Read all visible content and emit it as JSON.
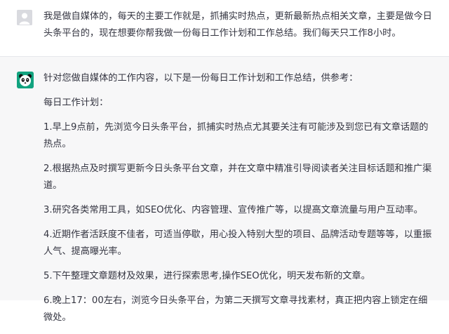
{
  "user_message": {
    "text": "我是做自媒体的，每天的主要工作就是，抓捕实时热点，更新最新热点相关文章，主要是做今日头条平台的，现在想要你帮我做一份每日工作计划和工作总结。我们每天只工作8小时。"
  },
  "assistant_message": {
    "intro": "针对您做自媒体的工作内容，以下是一份每日工作计划和工作总结，供参考：",
    "plan_title": "每日工作计划：",
    "items": [
      "1.早上9点前，先浏览今日头条平台，抓捕实时热点尤其要关注有可能涉及到您已有文章话题的热点。",
      "2.根据热点及时撰写更新今日头条平台文章，并在文章中精准引导阅读者关注目标话题和推广渠道。",
      "3.研究各类常用工具，如SEO优化、内容管理、宣传推广等，以提高文章流量与用户互动率。",
      "4.近期作者活跃度不佳者，可适当停歇，用心投入特别大型的项目、品牌活动专题等等，以重振人气、提高曝光率。",
      "5.下午整理文章题材及效果，进行探索思考,操作SEO优化，明天发布新的文章。",
      "6.晚上17：00左右，浏览今日头条平台，为第二天撰写文章寻找素材，真正把内容上锁定在细微处。"
    ]
  },
  "icons": {
    "user_avatar": "user-silhouette-icon",
    "assistant_avatar": "panda-icon"
  },
  "colors": {
    "assistant_bg": "#f7f7f8",
    "text": "#343541",
    "assistant_avatar_bg": "#12a37f"
  }
}
